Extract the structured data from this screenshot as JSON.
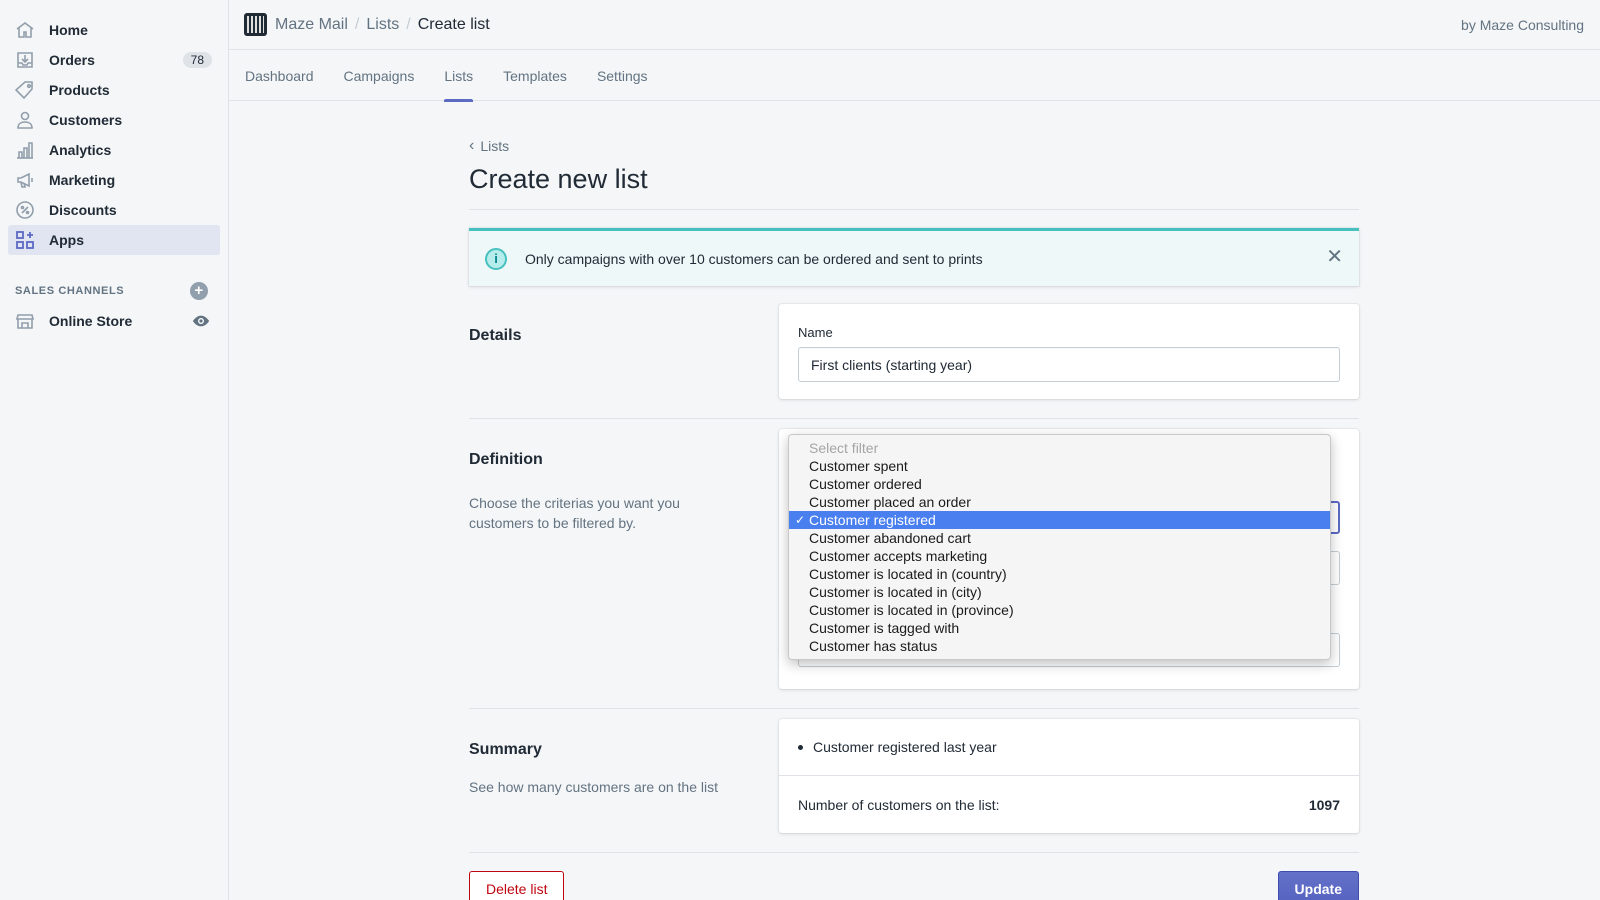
{
  "sidebar": {
    "items": [
      {
        "label": "Home",
        "icon": "home-icon"
      },
      {
        "label": "Orders",
        "icon": "orders-icon",
        "badge": "78"
      },
      {
        "label": "Products",
        "icon": "tag-icon"
      },
      {
        "label": "Customers",
        "icon": "person-icon"
      },
      {
        "label": "Analytics",
        "icon": "bar-chart-icon"
      },
      {
        "label": "Marketing",
        "icon": "megaphone-icon"
      },
      {
        "label": "Discounts",
        "icon": "discount-icon"
      },
      {
        "label": "Apps",
        "icon": "apps-icon",
        "active": true
      }
    ],
    "sales_channels_title": "SALES CHANNELS",
    "online_store_label": "Online Store"
  },
  "topbar": {
    "breadcrumb": [
      "Maze Mail",
      "Lists",
      "Create list"
    ],
    "byline": "by Maze Consulting"
  },
  "tabs": [
    "Dashboard",
    "Campaigns",
    "Lists",
    "Templates",
    "Settings"
  ],
  "active_tab": "Lists",
  "page": {
    "back_label": "Lists",
    "title": "Create new list",
    "banner_message": "Only campaigns with over 10 customers can be ordered and sent to prints"
  },
  "details": {
    "heading": "Details",
    "name_label": "Name",
    "name_value": "First clients (starting year)"
  },
  "definition": {
    "heading": "Definition",
    "description": "Choose the criterias you want you customers to be filtered by.",
    "filter_options": [
      "Select filter",
      "Customer spent",
      "Customer ordered",
      "Customer placed an order",
      "Customer registered",
      "Customer abandoned cart",
      "Customer accepts marketing",
      "Customer is located in (country)",
      "Customer is located in (city)",
      "Customer is located in (province)",
      "Customer is tagged with",
      "Customer has status"
    ],
    "selected_option": "Customer registered",
    "check_mark": "✓"
  },
  "summary": {
    "heading": "Summary",
    "description": "See how many customers are on the list",
    "criteria": [
      "Customer registered last year"
    ],
    "count_label": "Number of customers on the list:",
    "count_value": "1097"
  },
  "actions": {
    "delete_label": "Delete list",
    "update_label": "Update"
  },
  "colors": {
    "accent": "#5c6ac4",
    "banner_border": "#47c1bf",
    "danger": "#bf0711",
    "selected_option": "#4a7ff0"
  }
}
